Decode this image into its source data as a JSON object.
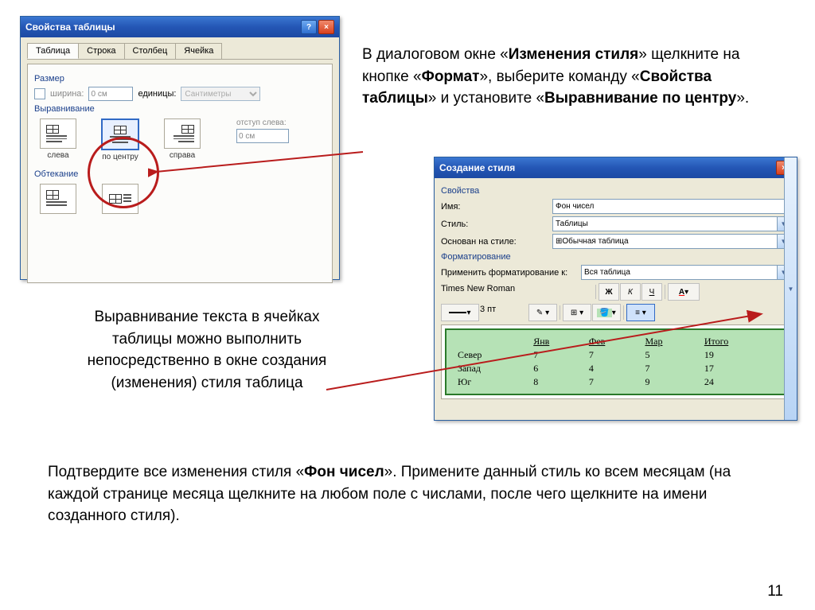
{
  "dialog1": {
    "title": "Свойства таблицы",
    "tabs": [
      "Таблица",
      "Строка",
      "Столбец",
      "Ячейка"
    ],
    "size_label": "Размер",
    "width_label": "ширина:",
    "width_value": "0 см",
    "units_label": "единицы:",
    "units_value": "Сантиметры",
    "align_label": "Выравнивание",
    "align_left": "слева",
    "align_center": "по центру",
    "align_right": "справа",
    "indent_label": "отступ слева:",
    "indent_value": "0 см",
    "wrap_label": "Обтекание"
  },
  "dialog2": {
    "title": "Создание стиля",
    "props_label": "Свойства",
    "name_label": "Имя:",
    "name_value": "Фон чисел",
    "style_label": "Стиль:",
    "style_value": "Таблицы",
    "based_label": "Основан на стиле:",
    "based_value": "Обычная таблица",
    "format_label": "Форматирование",
    "apply_label": "Применить форматирование к:",
    "apply_value": "Вся таблица",
    "font_value": "Times New Roman",
    "bold": "Ж",
    "italic": "К",
    "underline": "Ч",
    "border_width": "3 пт",
    "table": {
      "headers": [
        "",
        "Янв",
        "Фев",
        "Мар",
        "Итого"
      ],
      "rows": [
        [
          "Север",
          "7",
          "7",
          "5",
          "19"
        ],
        [
          "Запад",
          "6",
          "4",
          "7",
          "17"
        ],
        [
          "Юг",
          "8",
          "7",
          "9",
          "24"
        ]
      ]
    }
  },
  "text1": {
    "line1": " В диалоговом окне «",
    "b1": "Изменения стиля",
    "line2": "» щелкните на кнопке «",
    "b2": "Формат",
    "line3": "», выберите команду  «",
    "b3": "Свойства таблицы",
    "line4": "» и установите «",
    "b4": "Выравнивание по центру",
    "line5": "»."
  },
  "text2": "Выравнивание текста в ячейках таблицы можно выполнить непосредственно в окне создания (изменения) стиля таблица",
  "text3": {
    "p1": "Подтвердите все изменения стиля «",
    "b1": "Фон чисел",
    "p2": "». Примените данный стиль ко всем месяцам (на каждой странице месяца щелкните на любом поле с числами, после чего щелкните на имени созданного стиля)."
  },
  "pagenum": "11"
}
